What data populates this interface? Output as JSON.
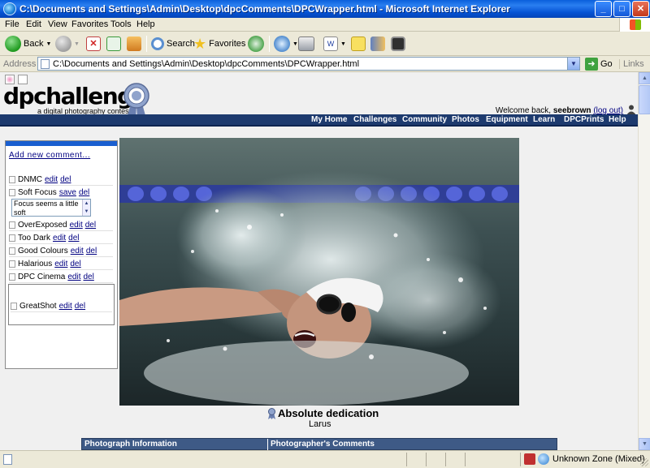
{
  "window": {
    "title": "C:\\Documents and Settings\\Admin\\Desktop\\dpcComments\\DPCWrapper.html - Microsoft Internet Explorer",
    "buttons": {
      "minimize": "_",
      "maximize": "□",
      "close": "✕"
    }
  },
  "menu": {
    "file": "File",
    "edit": "Edit",
    "view": "View",
    "favorites": "Favorites",
    "tools": "Tools",
    "help": "Help"
  },
  "toolbar": {
    "back": "Back",
    "search": "Search",
    "favorites": "Favorites"
  },
  "address": {
    "label": "Address",
    "url": "C:\\Documents and Settings\\Admin\\Desktop\\dpcComments\\DPCWrapper.html",
    "go": "Go",
    "links": "Links"
  },
  "site": {
    "logo": "dpchallenge",
    "tagline": "a digital photography contest",
    "welcome_prefix": "Welcome back, ",
    "username": "seebrown",
    "logout": "(log out)",
    "nav": [
      "My Home",
      "Challenges",
      "Community",
      "Photos",
      "Equipment",
      "Learn",
      "DPCPrints",
      "Help"
    ]
  },
  "sidebar": {
    "add_new": "Add new comment...",
    "edit_label": "edit",
    "del_label": "del",
    "save_label": "save",
    "comments": [
      {
        "name": "DNMC"
      },
      {
        "name": "Soft Focus"
      },
      {
        "name": "OverExposed"
      },
      {
        "name": "Too Dark"
      },
      {
        "name": "Good Colours"
      },
      {
        "name": "Halarious"
      },
      {
        "name": "DPC Cinema"
      }
    ],
    "edit_text": "Focus seems a little soft",
    "extra_comment": {
      "name": "GreatShot"
    }
  },
  "photo": {
    "title": "Absolute dedication",
    "author": "Larus"
  },
  "info_header": {
    "left": "Photograph Information",
    "right": "Photographer's Comments"
  },
  "status": {
    "zone": "Unknown Zone (Mixed)"
  }
}
